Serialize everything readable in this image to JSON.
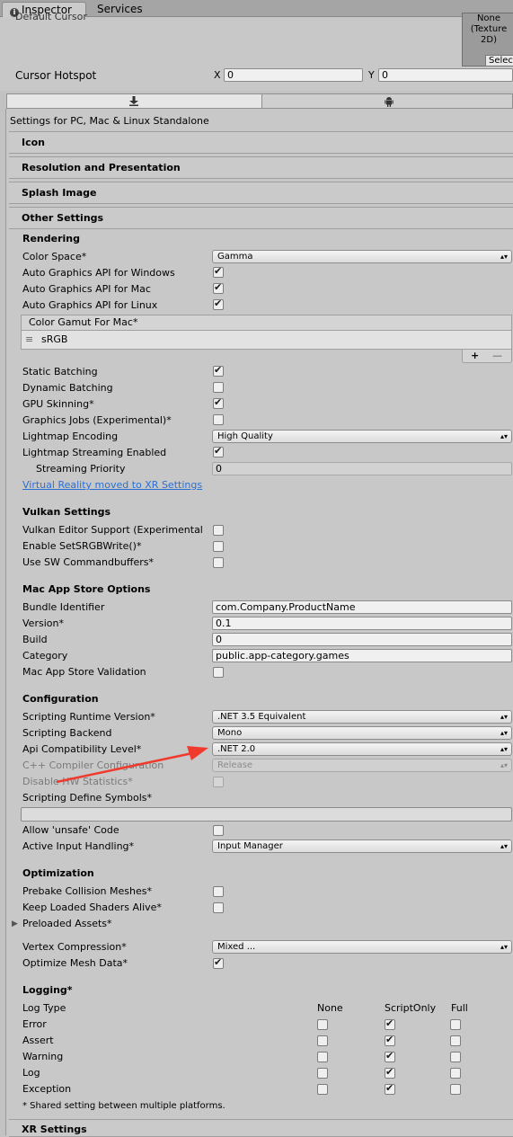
{
  "tabs": {
    "inspector": "Inspector",
    "services": "Services"
  },
  "cursor": {
    "default_label": "Default Cursor",
    "texture_label": "None (Texture 2D)",
    "select_label": "Select",
    "hotspot_label": "Cursor Hotspot",
    "x_label": "X",
    "x_value": "0",
    "y_label": "Y",
    "y_value": "0"
  },
  "platform_tabs": {
    "pc_icon": "download-icon",
    "android_icon": "android-icon"
  },
  "settings_title": "Settings for PC, Mac & Linux Standalone",
  "sections": {
    "icon": "Icon",
    "resolution": "Resolution and Presentation",
    "splash": "Splash Image",
    "other": "Other Settings",
    "xr": "XR Settings"
  },
  "rendering": {
    "header": "Rendering",
    "color_space_label": "Color Space*",
    "color_space_value": "Gamma",
    "auto_win": "Auto Graphics API  for Windows",
    "auto_mac": "Auto Graphics API  for Mac",
    "auto_linux": "Auto Graphics API  for Linux",
    "gamut_header": "Color Gamut For Mac*",
    "gamut_item": "sRGB",
    "plus": "+",
    "minus": "—",
    "static_batching": "Static Batching",
    "dynamic_batching": "Dynamic Batching",
    "gpu_skinning": "GPU Skinning*",
    "graphics_jobs": "Graphics Jobs (Experimental)*",
    "lightmap_encoding_label": "Lightmap Encoding",
    "lightmap_encoding_value": "High Quality",
    "lightmap_streaming": "Lightmap Streaming Enabled",
    "streaming_priority_label": "Streaming Priority",
    "streaming_priority_value": "0",
    "vr_link": "Virtual Reality moved to XR Settings"
  },
  "vulkan": {
    "header": "Vulkan Settings",
    "editor_support": "Vulkan Editor Support (Experimental",
    "srgb_write": "Enable SetSRGBWrite()*",
    "sw_cmd": "Use SW Commandbuffers*"
  },
  "mac_store": {
    "header": "Mac App Store Options",
    "bundle_label": "Bundle Identifier",
    "bundle_value": "com.Company.ProductName",
    "version_label": "Version*",
    "version_value": "0.1",
    "build_label": "Build",
    "build_value": "0",
    "category_label": "Category",
    "category_value": "public.app-category.games",
    "validation": "Mac App Store Validation"
  },
  "configuration": {
    "header": "Configuration",
    "runtime_label": "Scripting Runtime Version*",
    "runtime_value": ".NET 3.5 Equivalent",
    "backend_label": "Scripting Backend",
    "backend_value": "Mono",
    "api_label": "Api Compatibility Level*",
    "api_value": ".NET 2.0",
    "cpp_label": "C++ Compiler Configuration",
    "cpp_value": "Release",
    "hw_stats": "Disable HW Statistics*",
    "define_symbols": "Scripting Define Symbols*",
    "unsafe": "Allow 'unsafe' Code",
    "input_label": "Active Input Handling*",
    "input_value": "Input Manager"
  },
  "optimization": {
    "header": "Optimization",
    "prebake": "Prebake Collision Meshes*",
    "keep_shaders": "Keep Loaded Shaders Alive*",
    "preloaded": "Preloaded Assets*",
    "vertex_label": "Vertex Compression*",
    "vertex_value": "Mixed ...",
    "optimize_mesh": "Optimize Mesh Data*"
  },
  "logging": {
    "header": "Logging*",
    "type_label": "Log Type",
    "col_none": "None",
    "col_script": "ScriptOnly",
    "col_full": "Full",
    "rows": [
      "Error",
      "Assert",
      "Warning",
      "Log",
      "Exception"
    ],
    "note": "* Shared setting between multiple platforms."
  },
  "colors": {
    "annotation_arrow": "#f03a2e",
    "link": "#2a6fd6"
  }
}
